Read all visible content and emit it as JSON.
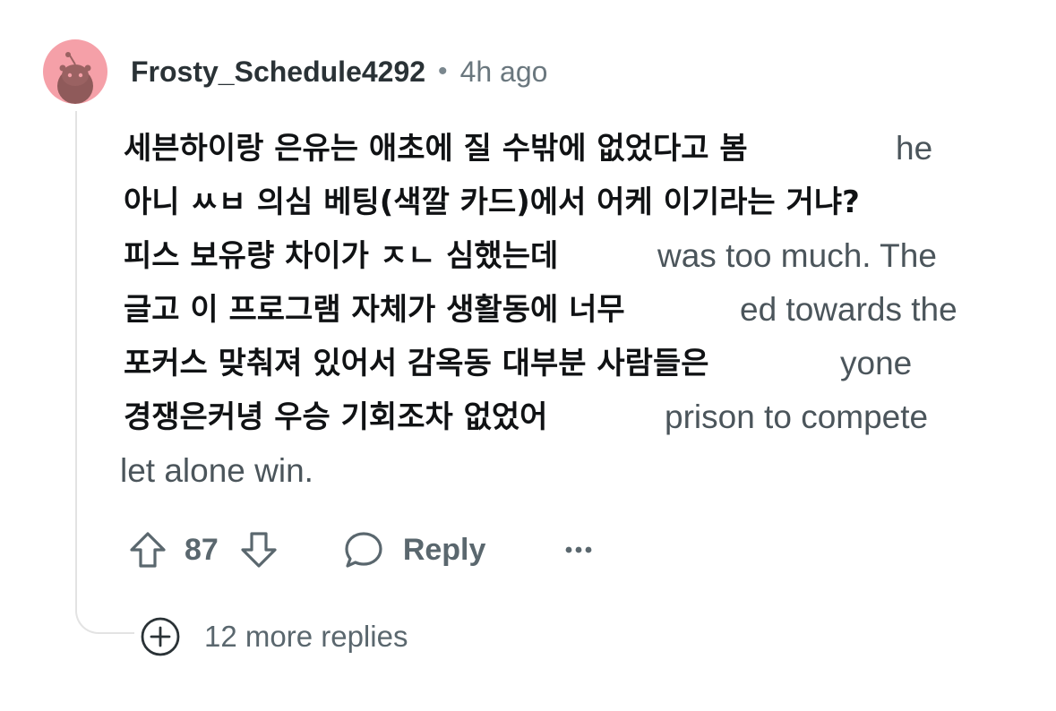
{
  "comment": {
    "username": "Frosty_Schedule4292",
    "separator": "•",
    "time": "4h ago",
    "lines": [
      {
        "under": "",
        "over": "세븐하이랑 은유는 애초에 질 수밖에 없었다고 봄",
        "visible_tail": "he"
      },
      {
        "under": "",
        "over": "아니 ㅆㅂ 의심 베팅(색깔 카드)에서 어케 이기라는 거냐?",
        "visible_tail": ""
      },
      {
        "under": "",
        "over": "피스 보유량 차이가 ㅈㄴ 심했는데",
        "visible_tail": "was too much. The"
      },
      {
        "under": "",
        "over": "글고 이 프로그램 자체가 생활동에 너무",
        "visible_tail": "ed towards the"
      },
      {
        "under": "",
        "over": "포커스 맞춰져 있어서 감옥동 대부분 사람들은",
        "visible_tail": "yone"
      },
      {
        "under": "",
        "over": "경쟁은커녕 우승 기회조차 없었어",
        "visible_tail": "prison to compete"
      }
    ],
    "last_line": "let alone win."
  },
  "actions": {
    "upvote_icon": "arrow-up-icon",
    "vote_count": "87",
    "downvote_icon": "arrow-down-icon",
    "reply_icon": "speech-bubble-icon",
    "reply_label": "Reply",
    "more_icon": "ellipsis-icon"
  },
  "more_replies": {
    "icon": "plus-circle-icon",
    "label": "12 more replies"
  },
  "colors": {
    "avatar_bg": "#f5a0a8",
    "text_gray": "#5a676e",
    "thread_line": "#e3e3e3"
  }
}
